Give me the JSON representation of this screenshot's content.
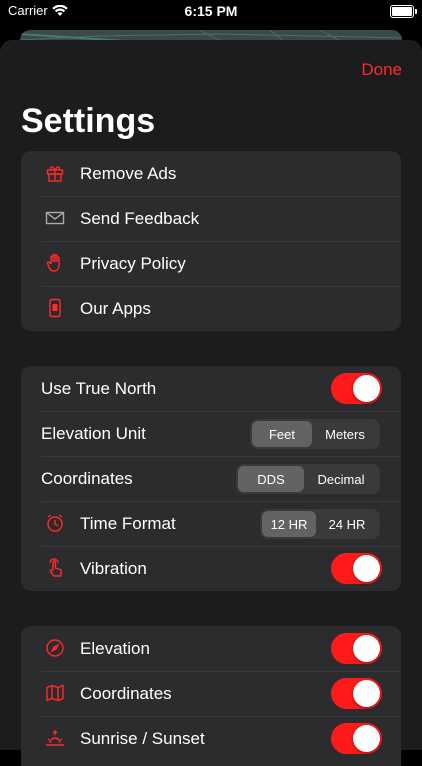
{
  "status": {
    "carrier": "Carrier",
    "time": "6:15 PM"
  },
  "header": {
    "done_label": "Done",
    "title": "Settings"
  },
  "group1": {
    "items": [
      {
        "label": "Remove Ads",
        "icon": "gift-icon"
      },
      {
        "label": "Send Feedback",
        "icon": "envelope-icon"
      },
      {
        "label": "Privacy Policy",
        "icon": "hand-icon"
      },
      {
        "label": "Our Apps",
        "icon": "phone-icon"
      }
    ]
  },
  "group2": {
    "use_true_north": {
      "label": "Use True North",
      "on": true
    },
    "elevation_unit": {
      "label": "Elevation Unit",
      "options": [
        "Feet",
        "Meters"
      ],
      "selected": "Feet"
    },
    "coordinates": {
      "label": "Coordinates",
      "options": [
        "DDS",
        "Decimal"
      ],
      "selected": "DDS"
    },
    "time_format": {
      "label": "Time Format",
      "icon": "clock-icon",
      "options": [
        "12 HR",
        "24 HR"
      ],
      "selected": "12 HR"
    },
    "vibration": {
      "label": "Vibration",
      "icon": "tap-icon",
      "on": true
    }
  },
  "group3": {
    "items": [
      {
        "label": "Elevation",
        "icon": "compass-icon",
        "on": true
      },
      {
        "label": "Coordinates",
        "icon": "map-icon",
        "on": true
      },
      {
        "label": "Sunrise / Sunset",
        "icon": "sunrise-icon",
        "on": true
      }
    ]
  },
  "colors": {
    "accent": "#ff1a1a",
    "background": "#1c1c1e",
    "card": "#2c2c2e"
  }
}
